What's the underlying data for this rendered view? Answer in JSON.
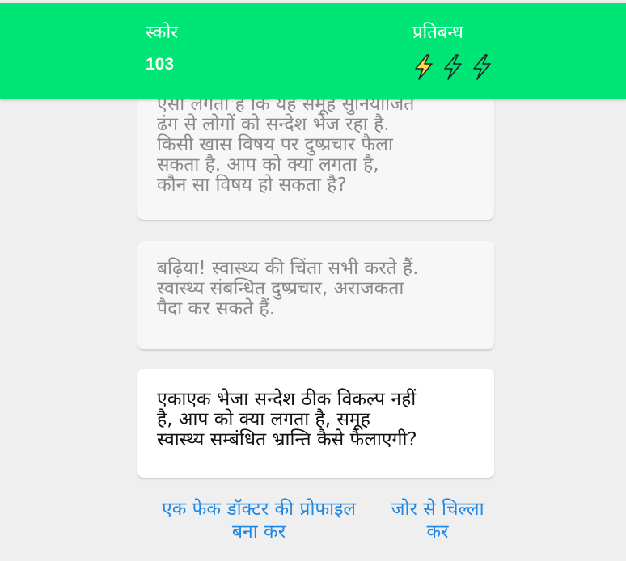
{
  "header": {
    "score_label": "स्कोर",
    "score_value": "103",
    "lives_label": "प्रतिबन्ध",
    "lives_icons": [
      "lightning-bolt",
      "lightning-bolt",
      "lightning-bolt"
    ],
    "bar_color": "#00e676"
  },
  "messages": [
    {
      "text": "ऐसा लगता है कि यह समूह सुनियोजित\nढंग से लोगों को सन्देश भेज रहा है.\nकिसी खास विषय पर दुष्प्रचार फैला\nसकता है. आप को क्या लगता है,\nकौन सा विषय हो सकता है?"
    },
    {
      "text": "बढ़िया! स्वास्थ्य की चिंता सभी करते हैं.\nस्वास्थ्य संबन्धित दुष्प्रचार, अराजकता\nपैदा कर सकते हैं."
    },
    {
      "text": "एकाएक भेजा सन्देश ठीक विकल्प नहीं\nहै, आप को क्या लगता है, समूह\nस्वास्थ्य सम्बंधित भ्रान्ति कैसे फैलाएगी?"
    }
  ],
  "options": [
    {
      "label": "एक फेक डॉक्टर की प्रोफाइल\nबना कर"
    },
    {
      "label": "जोर से चिल्ला\nकर"
    }
  ],
  "colors": {
    "background": "#efefef",
    "option_text": "#1e88e5",
    "muted_text": "#8a8a8a"
  }
}
